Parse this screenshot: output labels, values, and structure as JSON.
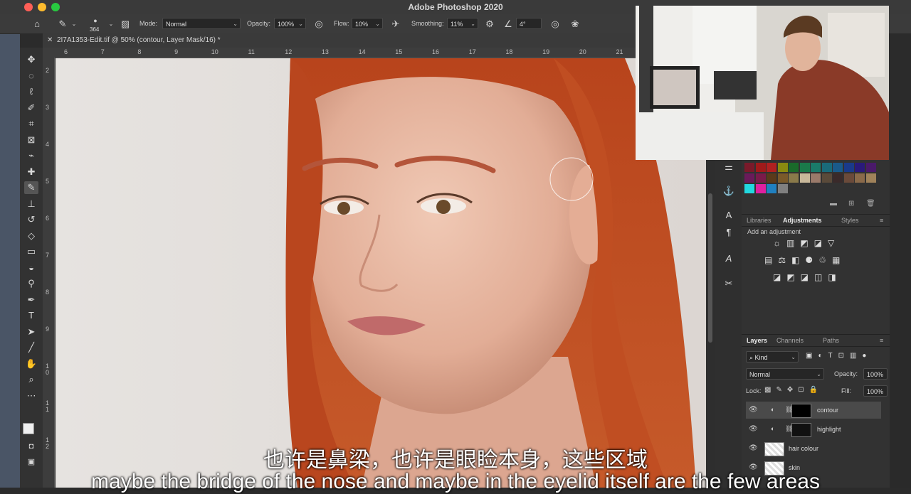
{
  "app": {
    "title": "Adobe Photoshop 2020"
  },
  "options": {
    "brush_size": "364",
    "mode_label": "Mode:",
    "mode_value": "Normal",
    "opacity_label": "Opacity:",
    "opacity_value": "100%",
    "flow_label": "Flow:",
    "flow_value": "10%",
    "smoothing_label": "Smoothing:",
    "smoothing_value": "11%",
    "angle_value": "4°"
  },
  "document": {
    "tab_title": "2I7A1353-Edit.tif @ 50% (contour, Layer Mask/16) *"
  },
  "ruler": {
    "top": [
      "6",
      "7",
      "8",
      "9",
      "10",
      "11",
      "12",
      "13",
      "14",
      "15",
      "16",
      "17",
      "18",
      "19",
      "20",
      "21"
    ],
    "left": [
      "2",
      "3",
      "4",
      "5",
      "6",
      "7",
      "8",
      "9",
      "1 0",
      "1 1",
      "1 2"
    ]
  },
  "panels": {
    "adjust_tabs": [
      "Libraries",
      "Adjustments",
      "Styles"
    ],
    "add_adjustment": "Add an adjustment",
    "layers_tabs": [
      "Layers",
      "Channels",
      "Paths"
    ],
    "kind_label": "Kind",
    "blend_mode": "Normal",
    "opacity_label": "Opacity:",
    "opacity_value": "100%",
    "lock_label": "Lock:",
    "fill_label": "Fill:",
    "fill_value": "100%",
    "layers": [
      {
        "name": "contour"
      },
      {
        "name": "highlight"
      },
      {
        "name": "hair colour"
      },
      {
        "name": "skin"
      }
    ],
    "swatch_colors": [
      "#7a1a2a",
      "#a01a1a",
      "#b02020",
      "#8a8a10",
      "#1a6a2a",
      "#1a7a4a",
      "#1a7a6a",
      "#1a6a7a",
      "#1a5a8a",
      "#1a3a8a",
      "#2a1a7a",
      "#4a1a6a",
      "#6a1a5a",
      "#7a1a4a",
      "#5a3a1a",
      "#7a5a2a",
      "#8a7a4a",
      "#c8b89a",
      "#9a7a6a",
      "#5a4a3a",
      "#3a2a2a",
      "#6a4a3a",
      "#8a6a4a",
      "#a0825a",
      "#22d8e0",
      "#e020a0",
      "#2080c0",
      "#808080"
    ]
  },
  "subtitles": {
    "cn": "也许是鼻梁，也许是眼睑本身，这些区域",
    "en": "maybe the bridge of the nose and maybe in the eyelid itself are the few areas"
  }
}
